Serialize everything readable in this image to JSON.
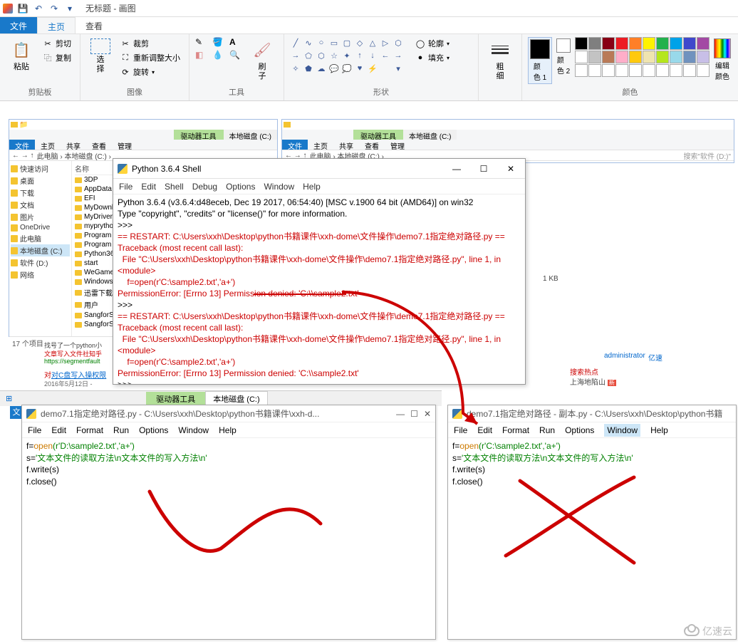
{
  "paint": {
    "title": "无标题 - 画图",
    "qat": {
      "save": "💾",
      "undo": "↶",
      "redo": "↷",
      "dropdown": "▾"
    },
    "tabs": {
      "file": "文件",
      "home": "主页",
      "view": "查看"
    },
    "groups": {
      "clipboard": {
        "label": "剪贴板",
        "paste": "粘贴",
        "cut": "剪切",
        "copy": "复制"
      },
      "image": {
        "label": "图像",
        "select": "选\n择",
        "crop": "裁剪",
        "resize": "重新调整大小",
        "rotate": "旋转"
      },
      "tools": {
        "label": "工具",
        "brush": "刷\n子"
      },
      "shapes": {
        "label": "形状",
        "outline": "轮廓",
        "fill": "填充"
      },
      "thickness": {
        "label": "粗\n细"
      },
      "colors": {
        "label": "颜色",
        "color1": "颜\n色 1",
        "color2": "颜\n色 2",
        "edit": "编辑\n颜色"
      }
    },
    "palette_row1": [
      "#000000",
      "#7f7f7f",
      "#880015",
      "#ed1c24",
      "#ff7f27",
      "#fff200",
      "#22b14c",
      "#00a2e8",
      "#3f48cc",
      "#a349a4"
    ],
    "palette_row2": [
      "#ffffff",
      "#c3c3c3",
      "#b97a57",
      "#ffaec9",
      "#ffc90e",
      "#efe4b0",
      "#b5e61d",
      "#99d9ea",
      "#7092be",
      "#c8bfe7"
    ],
    "palette_row3": [
      "#ffffff",
      "#ffffff",
      "#ffffff",
      "#ffffff",
      "#ffffff",
      "#ffffff",
      "#ffffff",
      "#ffffff",
      "#ffffff",
      "#ffffff"
    ]
  },
  "explorer1": {
    "contextual": "驱动器工具",
    "contextual2": "本地磁盘 (C:)",
    "tabs": [
      "文件",
      "主页",
      "共享",
      "查看",
      "管理"
    ],
    "breadcrumb": "此电脑 › 本地磁盘 (C:) ›",
    "nav": [
      {
        "label": "快速访问",
        "icon": "star"
      },
      {
        "label": "桌面"
      },
      {
        "label": "下载"
      },
      {
        "label": "文档"
      },
      {
        "label": "图片"
      },
      {
        "label": "OneDrive"
      },
      {
        "label": "此电脑"
      },
      {
        "label": "本地磁盘 (C:)",
        "sel": true
      },
      {
        "label": "软件 (D:)"
      },
      {
        "label": "网络"
      }
    ],
    "list_header": "名称",
    "items": [
      "3DP",
      "AppData",
      "EFI",
      "MyDownlo",
      "MyDrivers",
      "myprython",
      "Program F",
      "Program F",
      "Python36",
      "start",
      "WeGame",
      "Windows",
      "迅雷下载",
      "用户",
      "SangforSer",
      "SangforSer"
    ],
    "status": "17 个项目"
  },
  "explorer2": {
    "contextual": "驱动器工具",
    "contextual2": "本地磁盘 (C:)",
    "tabs": [
      "文件",
      "主页",
      "共享",
      "查看",
      "管理"
    ],
    "breadcrumb": "此电脑 › 本地磁盘 (C:) ›",
    "search_placeholder": "搜索\"软件 (D:)\"",
    "detail": "1 KB",
    "admin": "administrator",
    "speedlink": "亿速",
    "hotlabel": "搜索热点",
    "hotitem": "上海地陷山"
  },
  "pyshell": {
    "title": "Python 3.6.4 Shell",
    "menu": [
      "File",
      "Edit",
      "Shell",
      "Debug",
      "Options",
      "Window",
      "Help"
    ],
    "line1": "Python 3.6.4 (v3.6.4:d48eceb, Dec 19 2017, 06:54:40) [MSC v.1900 64 bit (AMD64)] on win32",
    "line2": "Type \"copyright\", \"credits\" or \"license()\" for more information.",
    "prompt": ">>> ",
    "restart": "== RESTART: C:\\Users\\xxh\\Desktop\\python书籍课件\\xxh-dome\\文件操作\\demo7.1指定绝对路径.py ==",
    "tb1": "Traceback (most recent call last):",
    "tb2": "  File \"C:\\Users\\xxh\\Desktop\\python书籍课件\\xxh-dome\\文件操作\\demo7.1指定绝对路径.py\", line 1, in <module>",
    "tb3": "    f=open(r'C:\\sample2.txt','a+')",
    "tb4": "PermissionError: [Errno 13] Permission denied: 'C:\\\\sample2.txt'"
  },
  "taskstrip": {
    "contextual": "驱动器工具",
    "disk": "本地磁盘 (C:)",
    "filebtn": "文"
  },
  "idle_left": {
    "title": "demo7.1指定绝对路径.py - C:\\Users\\xxh\\Desktop\\python书籍课件\\xxh-d...",
    "menu": [
      "File",
      "Edit",
      "Format",
      "Run",
      "Options",
      "Window",
      "Help"
    ],
    "code": {
      "l1a": "f=",
      "l1b": "open",
      "l1c": "(r'D:\\sample2.txt','a+')",
      "l2a": "s=",
      "l2b": "'文本文件的读取方法\\n文本文件的写入方法\\n'",
      "l3": "f.write(s)",
      "l4": "f.close()"
    }
  },
  "idle_right": {
    "title": "demo7.1指定绝对路径 - 副本.py - C:\\Users\\xxh\\Desktop\\python书籍",
    "menu": [
      "File",
      "Edit",
      "Format",
      "Run",
      "Options",
      "Window",
      "Help"
    ],
    "highlighted": "Window",
    "code": {
      "l1a": "f=",
      "l1b": "open",
      "l1c": "(r'C:\\sample2.txt','a+')",
      "l2a": "s=",
      "l2b": "'文本文件的读取方法\\n文本文件的写入方法\\n'",
      "l3": "f.write(s)",
      "l4": "f.close()"
    }
  },
  "snippets": {
    "seg1": "找号了一个python小",
    "seg2": "文章写入文件社知乎",
    "seg3": "https://segmentfault",
    "seg4": "对C盘写入操权限",
    "seg5": "2016年5月12日 -"
  },
  "watermark": "亿速云"
}
